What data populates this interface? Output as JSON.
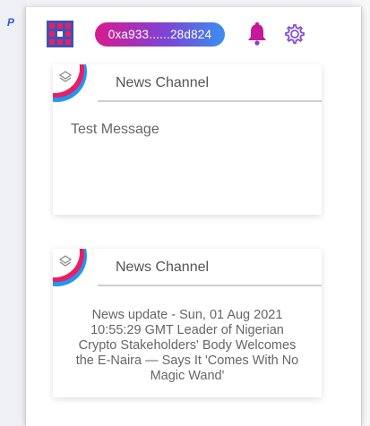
{
  "header": {
    "address": "0xa933......28d824"
  },
  "cards": [
    {
      "channel": "News Channel",
      "message": "Test Message"
    },
    {
      "channel": "News Channel",
      "message": "News update - Sun, 01 Aug 2021 10:55:29 GMT Leader of Nigerian Crypto Stakeholders' Body Welcomes the E-Naira — Says It 'Comes With No Magic Wand'"
    }
  ],
  "colors": {
    "pill_start": "#d81b8e",
    "pill_mid": "#7b45d6",
    "pill_end": "#3b8ff0",
    "bell": "#c7189a",
    "gear": "#7f4fd6"
  },
  "icons": {
    "logo": "grid-logo-icon",
    "bell": "bell-icon",
    "gear": "gear-icon",
    "channel": "channel-avatar-icon"
  }
}
